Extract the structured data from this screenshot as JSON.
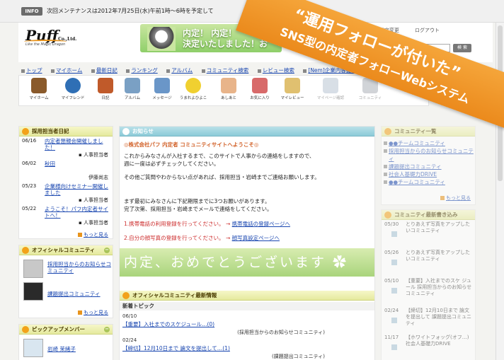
{
  "topbar": {
    "badge": "INFO",
    "notice": "次回メンテナンスは2012年7月25日(水)午前1時〜6時を予定して"
  },
  "header": {
    "logo": "Puff",
    "logo_suffix": "Co.,Ltd.",
    "logo_tagline": "Like the Magic Dragon",
    "banner_text_line1": "内定！ 内定！",
    "banner_text_line2": "決定いたしました！お",
    "login_label": "設定変更",
    "logout_label": "ログアウト",
    "search_button": "検 索"
  },
  "nav": {
    "links": [
      "トップ",
      "マイホーム",
      "最新日記",
      "ランキング",
      "アルバム",
      "コミュニティ検索",
      "レビュー検索",
      "[Nem]企業内容提案"
    ]
  },
  "iconbar": {
    "items": [
      {
        "label": "マイホーム",
        "icon": "house-icon",
        "color": "#8a5a2b"
      },
      {
        "label": "マイフレンド",
        "icon": "friends-icon",
        "color": "#2f6fb5"
      },
      {
        "label": "日記",
        "icon": "diary-icon",
        "color": "#c05a2a"
      },
      {
        "label": "アルバム",
        "icon": "album-icon",
        "color": "#7aa0c4"
      },
      {
        "label": "メッセージ",
        "icon": "message-icon",
        "color": "#6a96c8"
      },
      {
        "label": "うまれよひよこ",
        "icon": "chick-icon",
        "color": "#f0d030"
      },
      {
        "label": "あしあと",
        "icon": "footprint-icon",
        "color": "#e8b48a"
      },
      {
        "label": "お気に入り",
        "icon": "favorite-icon",
        "color": "#d86a6a"
      },
      {
        "label": "マイレビュー",
        "icon": "review-icon",
        "color": "#e0c070"
      },
      {
        "label": "マイページ確認",
        "icon": "page-check-icon",
        "color": "#a8b8c8"
      },
      {
        "label": "コミュニティ",
        "icon": "community-icon",
        "color": "#9aa0a8"
      }
    ]
  },
  "diary": {
    "title": "採用担当者日記",
    "entries": [
      {
        "date": "06/16",
        "title": "内定者懇親会開催しました！",
        "author": "人事担当者"
      },
      {
        "date": "06/02",
        "title": "秋田",
        "author": "伊藤尚志"
      },
      {
        "date": "05/23",
        "title": "企業様向けセミナー開催しました",
        "author": "人事担当者"
      },
      {
        "date": "05/22",
        "title": "ようこそ！パフ内定者サイトへ！",
        "author": "人事担当者"
      }
    ],
    "more": "もっと見る"
  },
  "official_community": {
    "title": "オフィシャルコミュニティ",
    "items": [
      "採用担当からのお知らせコミュニティ",
      "課題提出コミュニティ"
    ],
    "more": "もっと見る"
  },
  "pickup": {
    "title": "ピックアップメンバー",
    "members": [
      "岩崎 茉緒子"
    ]
  },
  "notice_box": {
    "title": "お知らせ",
    "welcome": "◎株式会社パフ 内定者 コミュニティサイトへようこそ◎",
    "p1_line1": "これからみなさんが入社するまで、このサイトで人事からの連絡をしますので、",
    "p1_line2": "週に一度は必ずチェックしてください。",
    "p2": "その他ご質問やわからない点があれば、採用担当・岩崎までご連絡お願いします。",
    "p3_line1": "まず最初にみなさんに下記期限までに3つお願いがあります。",
    "p3_line2": "完了次第、採用担当・岩崎までメールで連絡をしてください。",
    "task1": "1.携帯電話の利用登録を行ってください。",
    "task1_link": "携帯電話の登録ページへ",
    "task2": "2.自分の顔写真の登録を行ってください。",
    "task2_link": "顔写真設定ページへ",
    "grad_banner": "内定、おめでとうございます"
  },
  "newinfo": {
    "title": "オフィシャルコミュニティ最新情報",
    "topic_header": "新着トピック",
    "items": [
      {
        "date": "06/10",
        "title": "【重要】入社までのスケジュール…(0)",
        "source": "(採用担当からのお知らせコミュニティ)"
      },
      {
        "date": "02/24",
        "title": "【締切】12月10日まで 論文を提出して…(1)",
        "source": "(課題提出コミュニティ)"
      }
    ]
  },
  "right": {
    "community_list_title": "コミュニティ一覧",
    "community_links": [
      "●●チームコミュニティ",
      "採用担当からのお知らせコミュニティ",
      "課題提出コミュニティ",
      "社会人基礎力DRIVE",
      "●●チームコミュニティ"
    ],
    "more": "もっと見る",
    "new_posts_title": "コミュニティ最新書き込み",
    "posts": [
      {
        "date": "05/30",
        "text": "とりあえず写真をアップしたいコミュニティ"
      },
      {
        "date": "05/26",
        "text": "とりあえず写真をアップしたいコミュニティ"
      },
      {
        "date": "05/10",
        "text": "【重要】入社までのスケ ジュール 採用担当からのお知らせコミュニティ"
      },
      {
        "date": "02/24",
        "text": "【締切】12月10日まで 論文を提出して 課題提出コミュニティ"
      },
      {
        "date": "11/17",
        "text": "【ホワイトフォッグ(オフ…) 社会人基礎力DRIVE"
      }
    ]
  },
  "ribbon": {
    "line1": "“運用フォローが付いた”",
    "line2": "SNS型の内定者フォローWebシステム"
  }
}
